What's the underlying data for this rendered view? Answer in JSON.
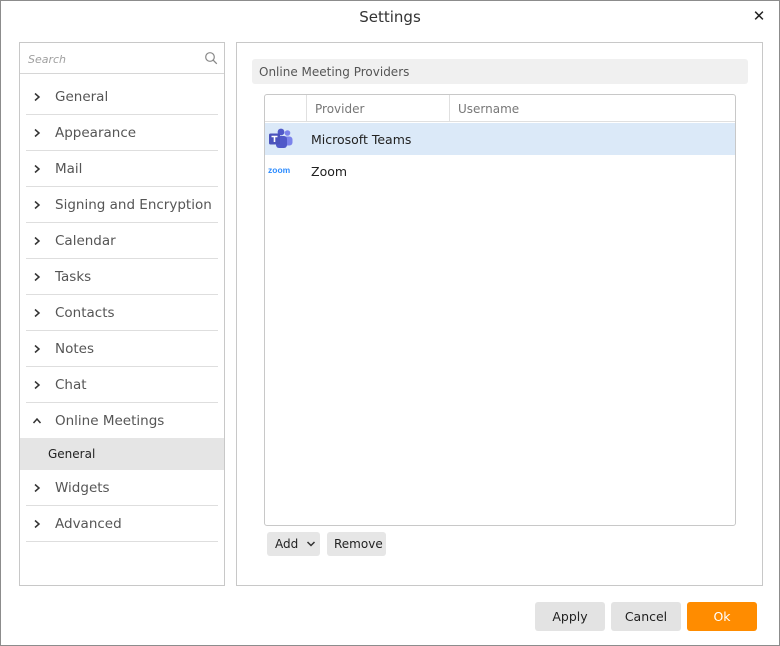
{
  "window": {
    "title": "Settings",
    "close_glyph": "✕"
  },
  "search": {
    "placeholder": "Search",
    "value": ""
  },
  "sidebar": {
    "items": [
      {
        "label": "General",
        "expanded": false
      },
      {
        "label": "Appearance",
        "expanded": false
      },
      {
        "label": "Mail",
        "expanded": false
      },
      {
        "label": "Signing and Encryption",
        "expanded": false
      },
      {
        "label": "Calendar",
        "expanded": false
      },
      {
        "label": "Tasks",
        "expanded": false
      },
      {
        "label": "Contacts",
        "expanded": false
      },
      {
        "label": "Notes",
        "expanded": false
      },
      {
        "label": "Chat",
        "expanded": false
      },
      {
        "label": "Online Meetings",
        "expanded": true,
        "children": [
          {
            "label": "General",
            "selected": true
          }
        ]
      },
      {
        "label": "Widgets",
        "expanded": false
      },
      {
        "label": "Advanced",
        "expanded": false
      }
    ]
  },
  "main": {
    "section_title": "Online Meeting Providers",
    "columns": [
      "",
      "Provider",
      "Username"
    ],
    "rows": [
      {
        "provider": "Microsoft Teams",
        "username": "",
        "icon": "microsoft-teams-icon",
        "selected": true
      },
      {
        "provider": "Zoom",
        "username": "",
        "icon": "zoom-icon",
        "selected": false
      }
    ],
    "zoom_logo_text": "zoom",
    "add_label": "Add",
    "remove_label": "Remove"
  },
  "footer": {
    "apply_label": "Apply",
    "cancel_label": "Cancel",
    "ok_label": "Ok"
  },
  "colors": {
    "accent": "#ff8c00",
    "selected_row": "#dbe9f8",
    "selected_nav": "#e5e5e5",
    "teams": "#5059c9",
    "zoom": "#2d8cff"
  }
}
